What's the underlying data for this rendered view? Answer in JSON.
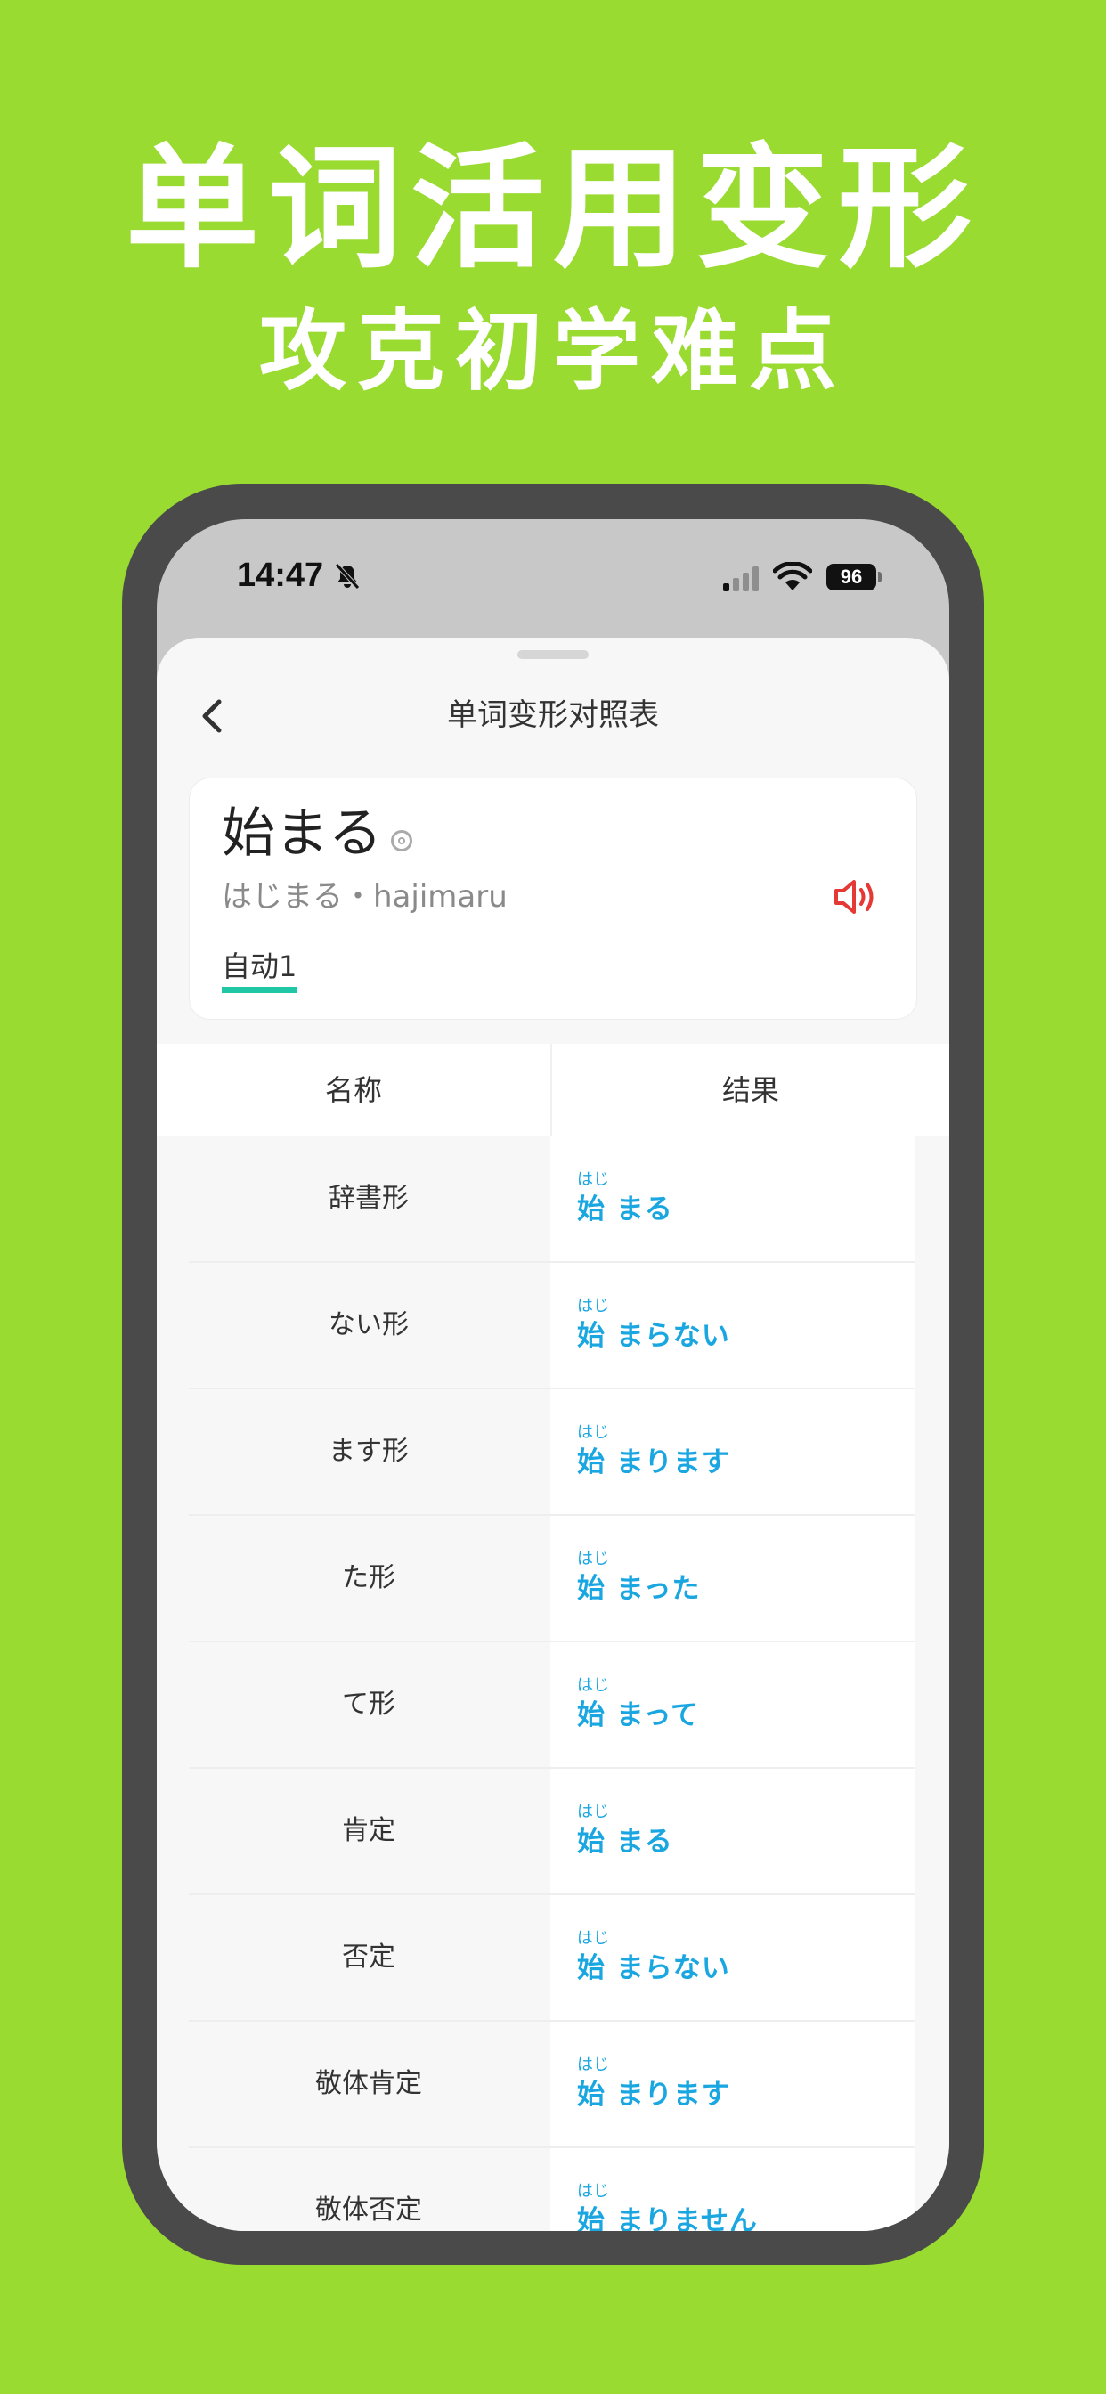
{
  "promo": {
    "title": "单词活用变形",
    "subtitle": "攻克初学难点"
  },
  "status_bar": {
    "time": "14:47",
    "battery": "96",
    "icons": [
      "bell-off-icon",
      "signal-icon",
      "wifi-icon",
      "battery-icon"
    ]
  },
  "header": {
    "title": "单词变形对照表",
    "back_icon": "chevron-left-icon"
  },
  "word": {
    "text": "始まる",
    "reading": "はじまる・hajimaru",
    "type": "自动1",
    "speaker_icon": "speaker-icon",
    "accent_color": "#E53935"
  },
  "table": {
    "headers": [
      "名称",
      "结果"
    ],
    "rows": [
      {
        "name": "辞書形",
        "ruby": "はじ",
        "result": "始 まる"
      },
      {
        "name": "ない形",
        "ruby": "はじ",
        "result": "始 まらない"
      },
      {
        "name": "ます形",
        "ruby": "はじ",
        "result": "始 まります"
      },
      {
        "name": "た形",
        "ruby": "はじ",
        "result": "始 まった"
      },
      {
        "name": "て形",
        "ruby": "はじ",
        "result": "始 まって"
      },
      {
        "name": "肯定",
        "ruby": "はじ",
        "result": "始 まる"
      },
      {
        "name": "否定",
        "ruby": "はじ",
        "result": "始 まらない"
      },
      {
        "name": "敬体肯定",
        "ruby": "はじ",
        "result": "始 まります"
      },
      {
        "name": "敬体否定",
        "ruby": "はじ",
        "result": "始 まりません"
      }
    ],
    "result_color": "#1AA6E0"
  },
  "colors": {
    "background": "#9ADB32",
    "phone_frame": "#4A4A4A",
    "type_underline": "#1FC7A6"
  }
}
